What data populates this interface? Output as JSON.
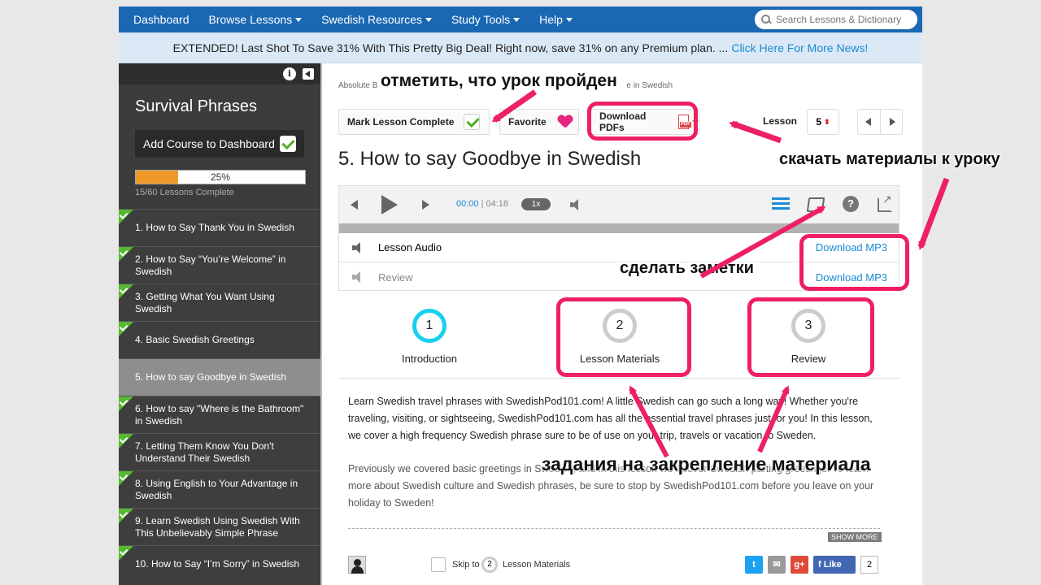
{
  "nav": {
    "items": [
      {
        "label": "Dashboard",
        "caret": false
      },
      {
        "label": "Browse Lessons",
        "caret": true
      },
      {
        "label": "Swedish Resources",
        "caret": true
      },
      {
        "label": "Study Tools",
        "caret": true
      },
      {
        "label": "Help",
        "caret": true
      }
    ],
    "search_placeholder": "Search Lessons & Dictionary"
  },
  "banner": {
    "text": "EXTENDED! Last Shot To Save 31% With This Pretty Big Deal! Right now, save 31% on any Premium plan. ...",
    "link": "Click Here For More News!"
  },
  "sidebar": {
    "info_icon": "i",
    "title": "Survival Phrases",
    "add_course": "Add Course to Dashboard",
    "progress": {
      "percent": 25,
      "label": "25%",
      "sub": "15/60 Lessons Complete"
    },
    "lessons": [
      {
        "label": "1. How to Say Thank You in Swedish",
        "done": true,
        "active": false
      },
      {
        "label": "2. How to Say “You’re Welcome” in Swedish",
        "done": true,
        "active": false
      },
      {
        "label": "3. Getting What You Want Using Swedish",
        "done": true,
        "active": false
      },
      {
        "label": "4. Basic Swedish Greetings",
        "done": true,
        "active": false
      },
      {
        "label": "5. How to say Goodbye in Swedish",
        "done": false,
        "active": true
      },
      {
        "label": "6. How to say \"Where is the Bathroom\" in Swedish",
        "done": true,
        "active": false
      },
      {
        "label": "7. Letting Them Know You Don't Understand Their Swedish",
        "done": true,
        "active": false
      },
      {
        "label": "8. Using English to Your Advantage in Swedish",
        "done": true,
        "active": false
      },
      {
        "label": "9. Learn Swedish Using Swedish With This Unbelievably Simple Phrase",
        "done": true,
        "active": false
      },
      {
        "label": "10. How to Say “I’m Sorry” in Swedish",
        "done": true,
        "active": false
      }
    ]
  },
  "main": {
    "breadcrumb_start": "Absolute B",
    "breadcrumb_end": "e in Swedish",
    "mark_complete": "Mark Lesson Complete",
    "favorite": "Favorite",
    "download_pdfs": "Download PDFs",
    "pdf_icon_label": "PDF",
    "lesson_label": "Lesson",
    "lesson_number": "5",
    "title": "5. How to say Goodbye in Swedish",
    "player": {
      "time_current": "00:00",
      "time_total": "04:18",
      "speed": "1x",
      "help_icon": "?",
      "rows": [
        {
          "label": "Lesson Audio",
          "link": "Download MP3"
        },
        {
          "label": "Review",
          "link": "Download MP3"
        }
      ]
    },
    "steps": [
      {
        "num": "1",
        "label": "Introduction"
      },
      {
        "num": "2",
        "label": "Lesson Materials"
      },
      {
        "num": "3",
        "label": "Review"
      }
    ],
    "paragraphs": [
      "Learn Swedish travel phrases with SwedishPod101.com! A little Swedish can go such a long way! Whether you're traveling, visiting, or sightseeing, SwedishPod101.com has all the essential travel phrases just for you! In this lesson, we cover a high frequency Swedish phrase sure to be of use on your trip, travels or vacation to Sweden.",
      "Previously we covered basic greetings in Swedish, and in this lesson we'll cover Swedish parting greetings. To learn more about Swedish culture and Swedish phrases, be sure to stop by SwedishPod101.com before you leave on your holiday to Sweden!"
    ],
    "show_more": "SHOW MORE",
    "footer": {
      "skip_to": "Skip to",
      "skip_step_num": "2",
      "skip_step_label": "Lesson Materials",
      "twitter_glyph": "t",
      "google_plus": "g+",
      "fb_like": "Like",
      "fb_count": "2"
    }
  },
  "annotations": {
    "mark_done": "отметить, что урок пройден",
    "download_materials": "скачать материалы к уроку",
    "take_notes": "сделать заметки",
    "exercises": "задания на закрепление материала"
  },
  "colors": {
    "accent": "#ee1f63",
    "nav": "#1a68b3",
    "link": "#1a8bd6",
    "progress": "#f09928",
    "done": "#58b832"
  }
}
